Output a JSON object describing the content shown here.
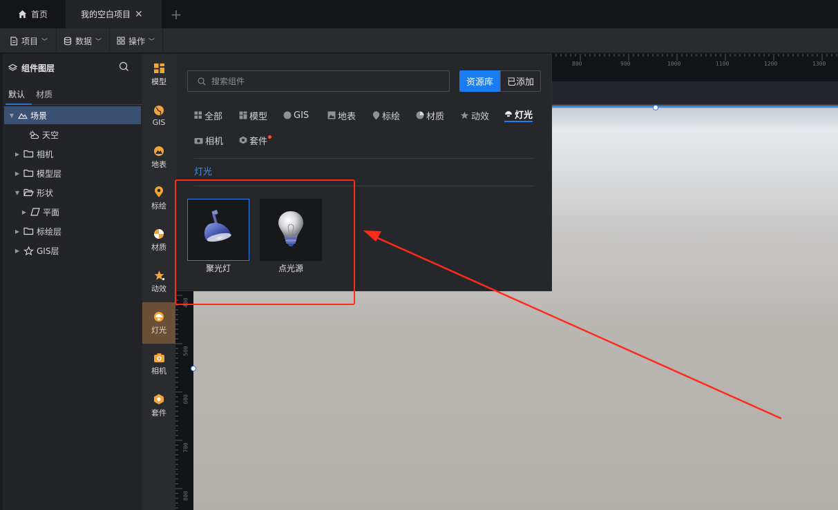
{
  "tabs": {
    "home_label": "首页",
    "project_label": "我的空白项目",
    "add_symbol": "+"
  },
  "menubar": {
    "project": "项目",
    "data": "数据",
    "operations": "操作"
  },
  "layer_panel": {
    "title": "组件图层",
    "tab_default": "默认",
    "tab_material": "材质",
    "tree": [
      {
        "label": "场景",
        "icon": "scene-icon",
        "expanded": true,
        "selected": true
      },
      {
        "label": "天空",
        "icon": "sky-icon"
      },
      {
        "label": "相机",
        "icon": "folder-icon"
      },
      {
        "label": "模型层",
        "icon": "folder-icon"
      },
      {
        "label": "形状",
        "icon": "folder-icon",
        "expanded": true
      },
      {
        "label": "平面",
        "icon": "plane-icon"
      },
      {
        "label": "标绘层",
        "icon": "folder-icon"
      },
      {
        "label": "GIS层",
        "icon": "gis-icon"
      }
    ]
  },
  "iconbar": [
    {
      "label": "模型"
    },
    {
      "label": "GIS"
    },
    {
      "label": "地表"
    },
    {
      "label": "标绘"
    },
    {
      "label": "材质"
    },
    {
      "label": "动效"
    },
    {
      "label": "灯光",
      "active": true
    },
    {
      "label": "相机"
    },
    {
      "label": "套件"
    }
  ],
  "popup": {
    "search_placeholder": "搜索组件",
    "btn_library": "资源库",
    "btn_added": "已添加",
    "categories": [
      "全部",
      "模型",
      "GIS",
      "地表",
      "标绘",
      "材质",
      "动效",
      "灯光",
      "相机",
      "套件"
    ],
    "active_category": "灯光",
    "section_title": "灯光",
    "items": [
      {
        "label": "聚光灯",
        "icon": "spotlight-icon",
        "selected": true
      },
      {
        "label": "点光源",
        "icon": "bulb-icon"
      }
    ]
  },
  "ruler": {
    "top": [
      "800",
      "900",
      "1000",
      "1100",
      "1200",
      "1300"
    ],
    "left": [
      "400",
      "500",
      "600",
      "700",
      "800"
    ]
  },
  "colors": {
    "accent": "#1a7cf0",
    "active_tool": "#6b4f37",
    "annotation": "#ff2a1a"
  }
}
